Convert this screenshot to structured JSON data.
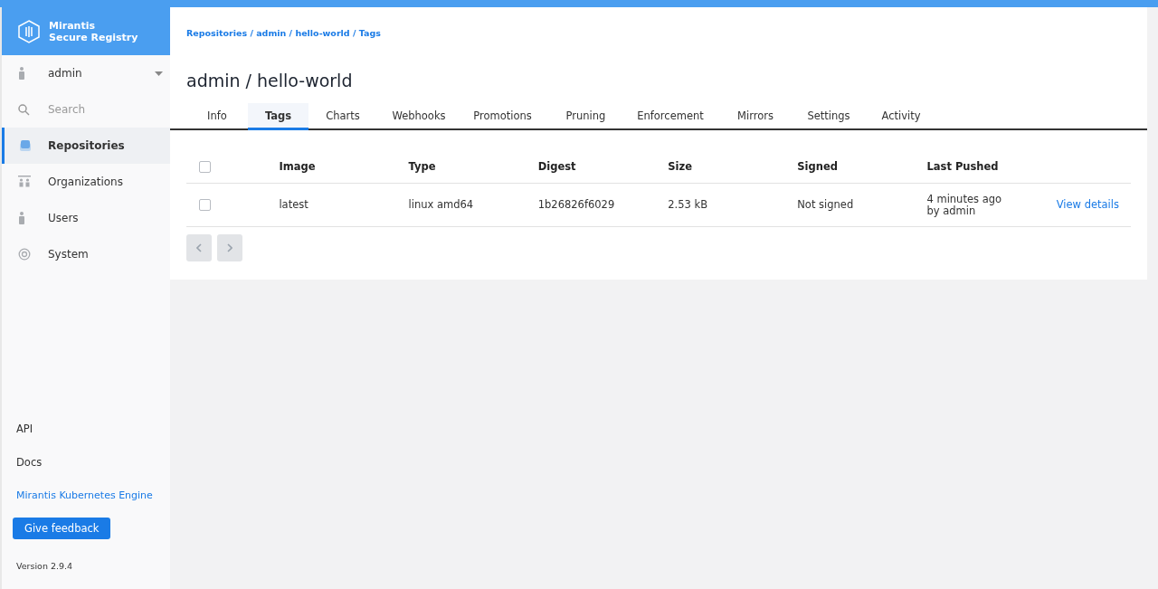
{
  "brand": {
    "line_1": "Mirantis",
    "line_2": "Secure Registry"
  },
  "sidebar": {
    "user": {
      "name": "admin"
    },
    "search": {
      "placeholder": "Search"
    },
    "items": [
      {
        "label": "Repositories",
        "kind": "repositories",
        "selected": true
      },
      {
        "label": "Organizations",
        "kind": "organizations",
        "selected": false
      },
      {
        "label": "Users",
        "kind": "users",
        "selected": false
      },
      {
        "label": "System",
        "kind": "system",
        "selected": false
      }
    ],
    "footer_links": [
      {
        "label": "API",
        "kind": "plain"
      },
      {
        "label": "Docs",
        "kind": "plain"
      },
      {
        "label": "Mirantis Kubernetes Engine",
        "kind": "link"
      }
    ],
    "feedback_button": "Give feedback",
    "version": "Version 2.9.4"
  },
  "breadcrumb": "Repositories / admin / hello-world / Tags",
  "title": "admin / hello-world",
  "tabs": [
    {
      "label": "Info",
      "selected": false
    },
    {
      "label": "Tags",
      "selected": true
    },
    {
      "label": "Charts",
      "selected": false
    },
    {
      "label": "Webhooks",
      "selected": false
    },
    {
      "label": "Promotions",
      "selected": false
    },
    {
      "label": "Pruning",
      "selected": false
    },
    {
      "label": "Enforcement",
      "selected": false
    },
    {
      "label": "Mirrors",
      "selected": false
    },
    {
      "label": "Settings",
      "selected": false
    },
    {
      "label": "Activity",
      "selected": false
    }
  ],
  "table": {
    "select_all_checked": false,
    "columns": [
      "Image",
      "Type",
      "Digest",
      "Size",
      "Signed",
      "Last Pushed"
    ],
    "rows": [
      {
        "checked": false,
        "cells": [
          "latest",
          "linux amd64",
          "1b26826f6029",
          "2.53 kB",
          "Not signed"
        ],
        "last_pushed": [
          "4 minutes ago",
          "by admin"
        ],
        "action": "View details"
      }
    ]
  },
  "pager": [
    {
      "kind": "prev",
      "disabled": true
    },
    {
      "kind": "next",
      "disabled": true
    }
  ]
}
